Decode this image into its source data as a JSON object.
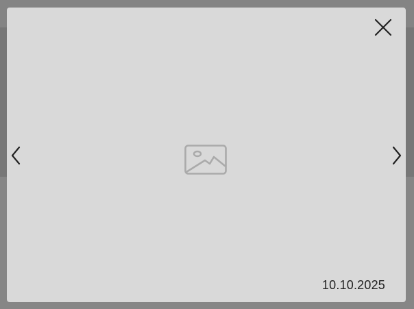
{
  "lightbox": {
    "close_icon": "close-icon",
    "prev_icon": "chevron-left-icon",
    "next_icon": "chevron-right-icon",
    "placeholder_icon": "image-placeholder-icon",
    "date": "10.10.2025"
  },
  "colors": {
    "overlay": "#7e7e7e",
    "panel": "#d9d9d9",
    "icon_dark": "#222222",
    "placeholder_gray": "#aaaaaa"
  }
}
